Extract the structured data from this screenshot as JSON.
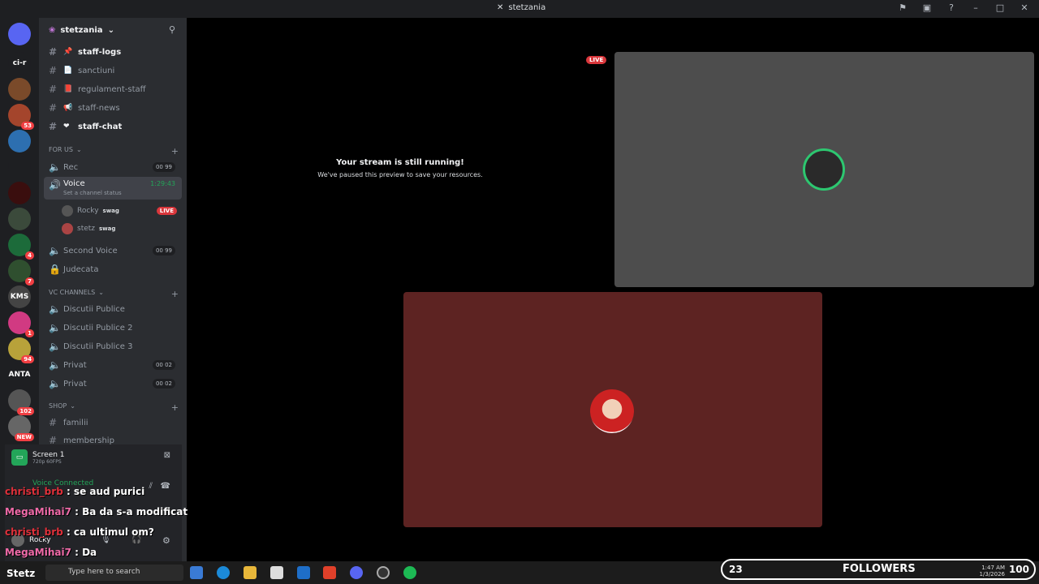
{
  "titlebar": {
    "title": "stetzania"
  },
  "rail": {
    "servers": [
      {
        "label": "",
        "color": "#5865f2",
        "badge": ""
      },
      {
        "label": "ci-r",
        "color": "#1e1f22",
        "badge": ""
      },
      {
        "label": "",
        "color": "#7a4a2a",
        "badge": ""
      },
      {
        "label": "",
        "color": "#a4452c",
        "badge": "53"
      },
      {
        "label": "",
        "color": "#2d6fb0",
        "badge": ""
      },
      {
        "label": "",
        "color": "#1e1f22",
        "badge": ""
      },
      {
        "label": "",
        "color": "#3a0e0e",
        "badge": ""
      },
      {
        "label": "",
        "color": "#3b4a3b",
        "badge": ""
      },
      {
        "label": "",
        "color": "#1c6b3a",
        "badge": "4"
      },
      {
        "label": "",
        "color": "#2f4f2f",
        "badge": "7"
      },
      {
        "label": "KMS",
        "color": "#444",
        "badge": ""
      },
      {
        "label": "",
        "color": "#d13a82",
        "badge": "1"
      },
      {
        "label": "",
        "color": "#b8a23a",
        "badge": "94"
      },
      {
        "label": "ANTA",
        "color": "#1e1f22",
        "badge": ""
      },
      {
        "label": "",
        "color": "#555",
        "badge": "102"
      },
      {
        "label": "",
        "color": "#666",
        "badge": "NEW"
      }
    ]
  },
  "sidebar": {
    "guild_name": "stetzania",
    "channels": [
      {
        "name": "staff-logs",
        "emoji": "📌",
        "bold": true
      },
      {
        "name": "sanctiuni",
        "emoji": "📄",
        "bold": false
      },
      {
        "name": "regulament-staff",
        "emoji": "📕",
        "bold": false
      },
      {
        "name": "staff-news",
        "emoji": "📢",
        "bold": false
      },
      {
        "name": "staff-chat",
        "emoji": "❤",
        "bold": true
      }
    ],
    "cat_for_us": "FOR US",
    "rec": {
      "name": "Rec",
      "count": "00 99"
    },
    "voice": {
      "name": "Voice",
      "timer": "1:29:43",
      "status": "Set a channel status"
    },
    "members": [
      {
        "name": "Rocky",
        "tag": "swag",
        "live": "LIVE"
      },
      {
        "name": "stetz",
        "tag": "swag",
        "live": ""
      }
    ],
    "second_voice": {
      "name": "Second Voice",
      "count": "00 99"
    },
    "judecata": {
      "name": "Judecata"
    },
    "cat_vc": "VC CHANNELS",
    "vc_channels": [
      {
        "name": "Discutii Publice",
        "count": ""
      },
      {
        "name": "Discutii Publice 2",
        "count": ""
      },
      {
        "name": "Discutii Publice 3",
        "count": ""
      },
      {
        "name": "Privat",
        "count": "00 02"
      },
      {
        "name": "Privat",
        "count": "00 02"
      }
    ],
    "cat_shop": "SHOP",
    "shop_channels": [
      {
        "name": "familii"
      },
      {
        "name": "membership"
      }
    ]
  },
  "panel": {
    "screen_title": "Screen 1",
    "screen_sub": "720p 60FPS",
    "voice_connected": "Voice Connected",
    "user": "Rocky"
  },
  "chat": [
    {
      "name": "christi_brb",
      "text": " : se aud purici",
      "color": "n1"
    },
    {
      "name": "MegaMihai7",
      "text": " : Ba da s-a modificat",
      "color": "n2"
    },
    {
      "name": "christi_brb",
      "text": " : ca ultimul om?",
      "color": "n1"
    },
    {
      "name": "MegaMihai7",
      "text": " : Da",
      "color": "n2"
    }
  ],
  "stream": {
    "paused_title": "Your stream is still running!",
    "paused_text": "We've paused this preview to save your resources.",
    "live": "LIVE"
  },
  "taskbar": {
    "search": "Type here to search",
    "followers_count": "23",
    "followers_label": "FOLLOWERS",
    "followers_goal": "100",
    "time": "1:47 AM",
    "date": "1/3/2026",
    "overlay_name": "Stetz"
  }
}
